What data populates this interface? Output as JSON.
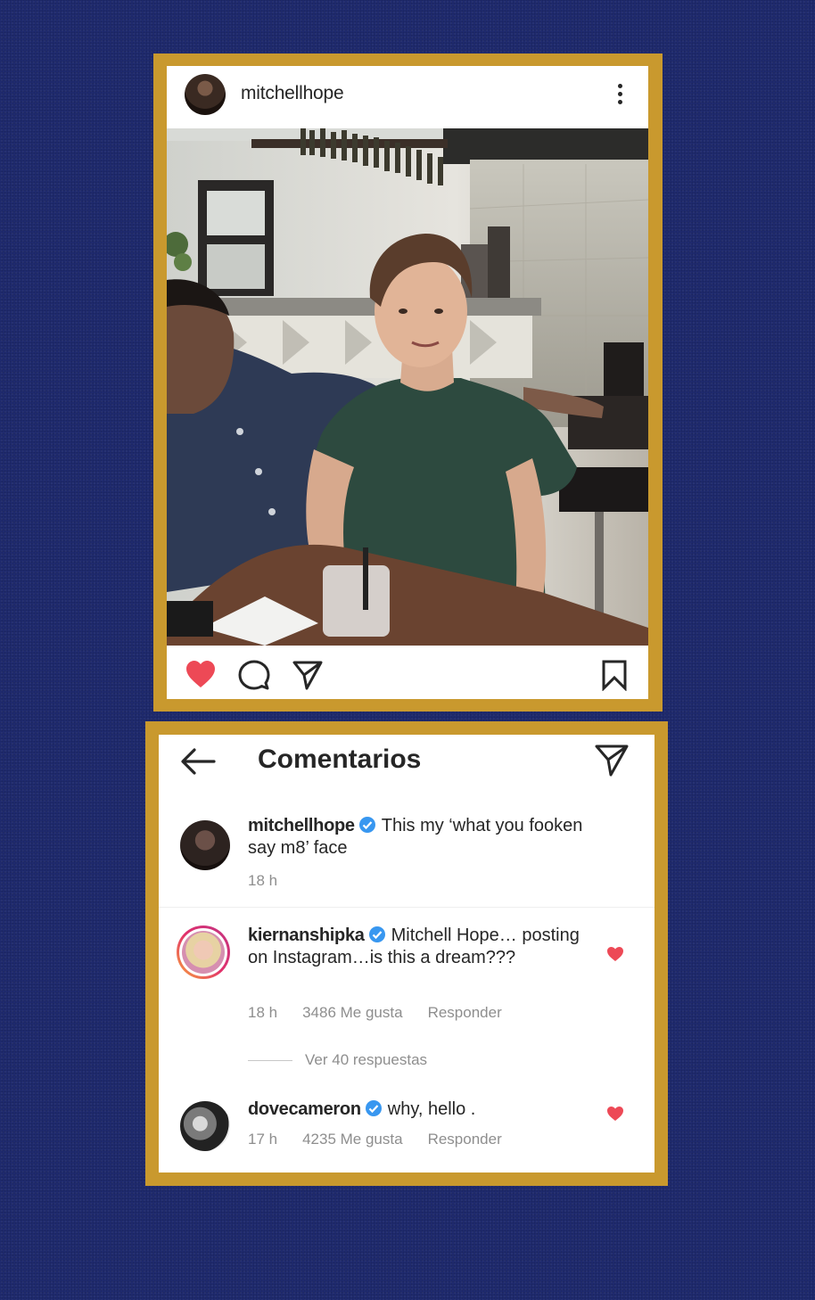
{
  "post": {
    "username": "mitchellhope",
    "liked": true
  },
  "comments_screen": {
    "title": "Comentarios",
    "comments": [
      {
        "username": "mitchellhope",
        "verified": true,
        "text": "This my ‘what you fooken say m8’ face",
        "time": "18 h"
      },
      {
        "username": "kiernanshipka",
        "verified": true,
        "text": "Mitchell Hope… posting on Instagram…is this a dream???",
        "time": "18 h",
        "likes": "3486 Me gusta",
        "reply_label": "Responder",
        "view_replies": "Ver 40 respuestas"
      },
      {
        "username": "dovecameron",
        "verified": true,
        "text": "why, hello .",
        "time": "17 h",
        "likes": "4235 Me gusta",
        "reply_label": "Responder"
      }
    ]
  },
  "colors": {
    "background": "#1f2a6e",
    "frame": "#c9992e",
    "like_red": "#ed4956",
    "verified_blue": "#3897f0"
  }
}
